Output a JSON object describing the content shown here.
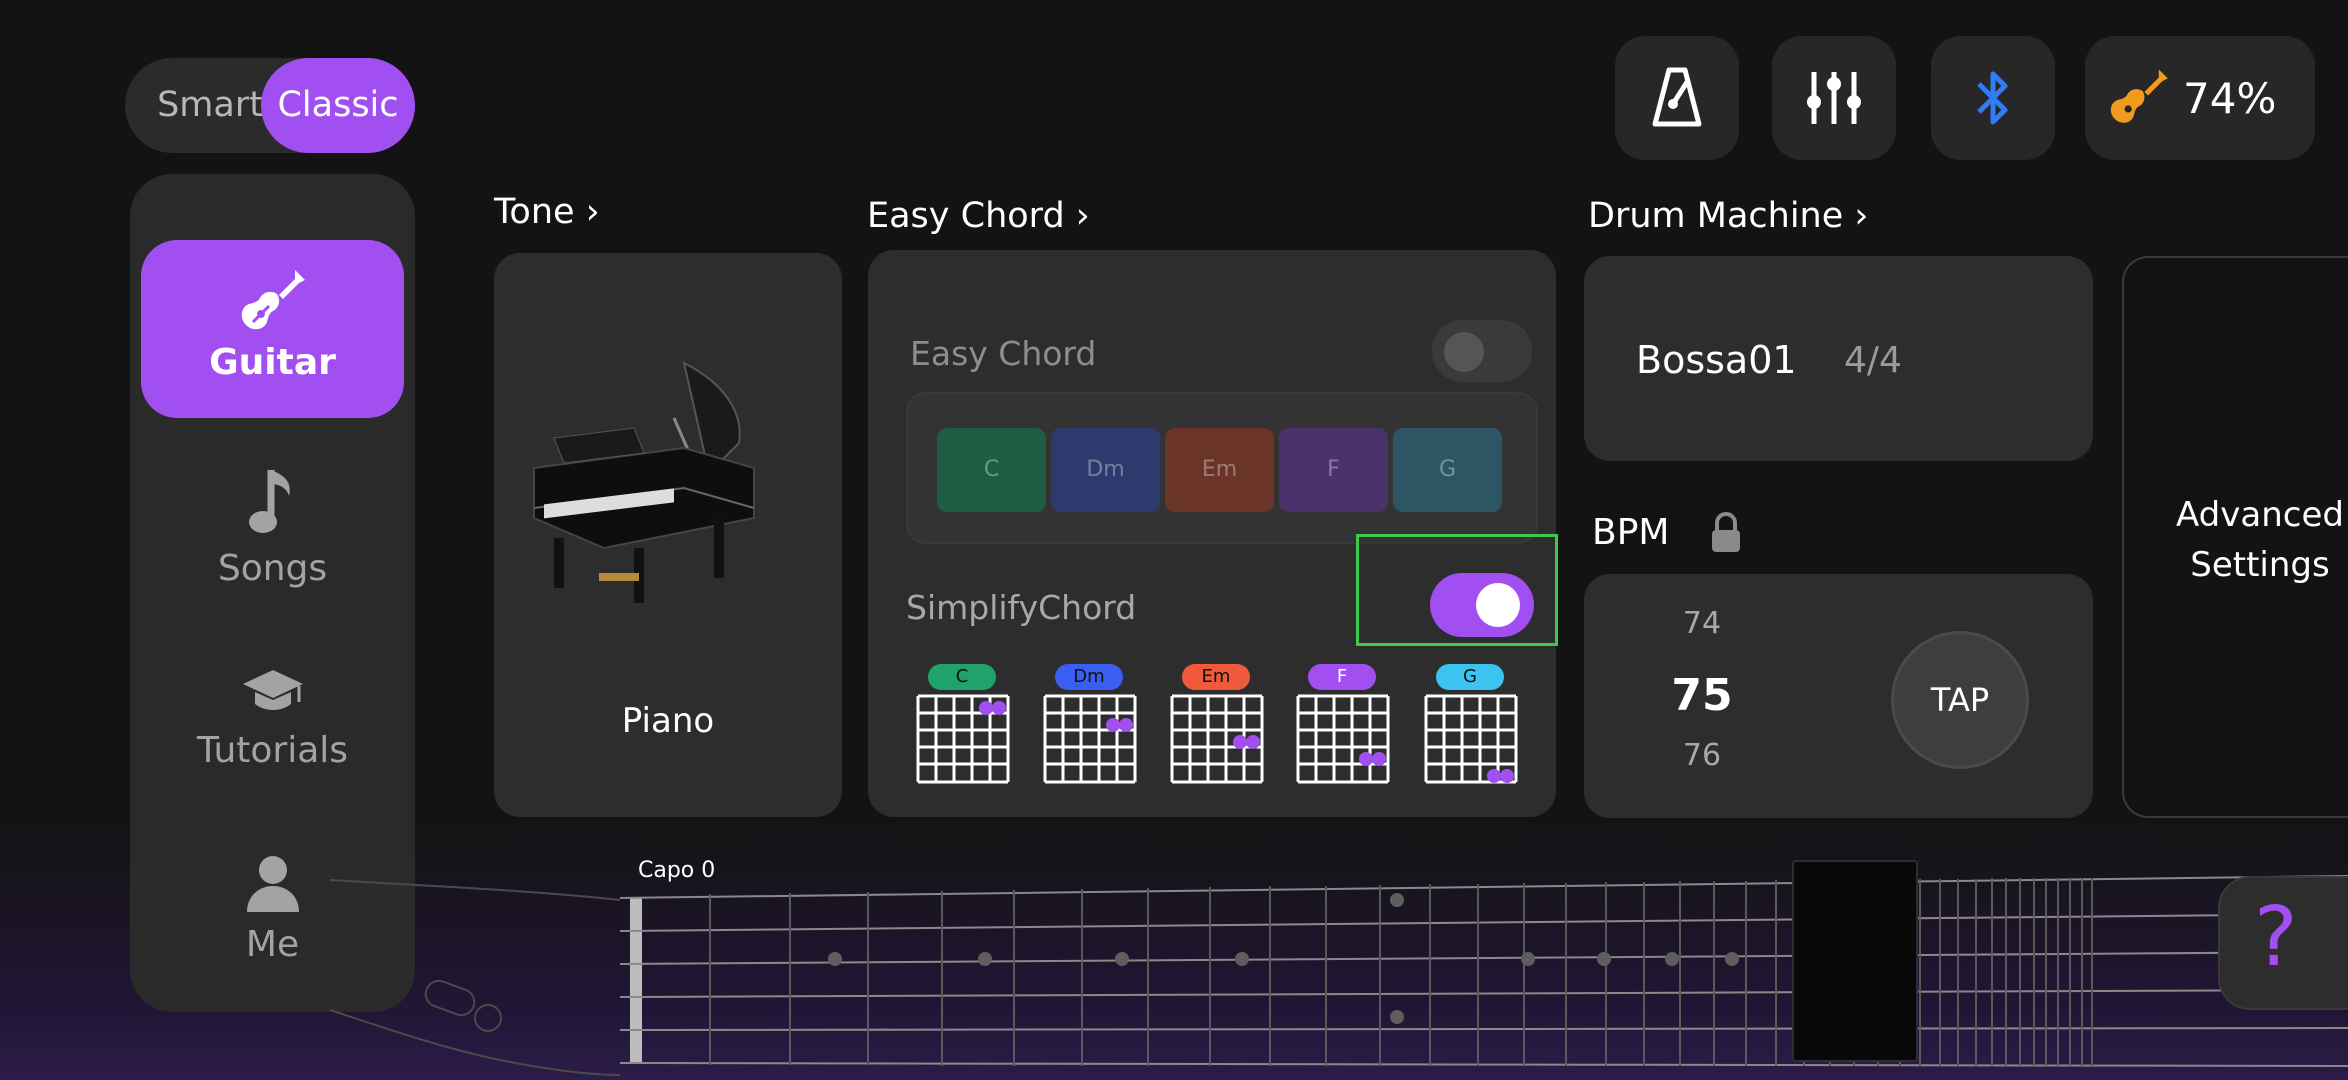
{
  "mode_toggle": {
    "smart": "Smart",
    "classic": "Classic",
    "selected": "Classic"
  },
  "sidebar": {
    "items": [
      {
        "label": "Guitar",
        "icon": "guitar-icon",
        "active": true
      },
      {
        "label": "Songs",
        "icon": "music-note-icon",
        "active": false
      },
      {
        "label": "Tutorials",
        "icon": "graduation-cap-icon",
        "active": false
      },
      {
        "label": "Me",
        "icon": "person-icon",
        "active": false
      }
    ]
  },
  "toolbar": {
    "metronome_icon": "metronome-icon",
    "mixer_icon": "sliders-icon",
    "bluetooth_icon": "bluetooth-icon",
    "battery_percent": "74%"
  },
  "tone": {
    "title": "Tone",
    "instrument": "Piano"
  },
  "easy_chord": {
    "title": "Easy Chord",
    "toggle_label": "Easy Chord",
    "toggle_on": false,
    "chords": [
      "C",
      "Dm",
      "Em",
      "F",
      "G"
    ],
    "simplify_label": "SimplifyChord",
    "simplify_on": true
  },
  "drum_machine": {
    "title": "Drum Machine",
    "pattern": "Bossa01",
    "time_signature": "4/4"
  },
  "bpm": {
    "label": "BPM",
    "prev": "74",
    "current": "75",
    "next": "76",
    "tap": "TAP"
  },
  "advanced": {
    "line1": "Advanced",
    "line2": "Settings"
  },
  "fretboard": {
    "capo": "Capo 0"
  },
  "help": {
    "icon": "question-icon",
    "text": "?"
  },
  "colors": {
    "accent": "#a24ff2",
    "chord_C": "#1fa36b",
    "chord_Dm": "#3a5ef0",
    "chord_Em": "#f05a3a",
    "chord_F": "#a24ff2",
    "chord_G": "#3cc3f0",
    "bluetooth": "#2f7cf6",
    "guitar_orange": "#f29a1e"
  }
}
